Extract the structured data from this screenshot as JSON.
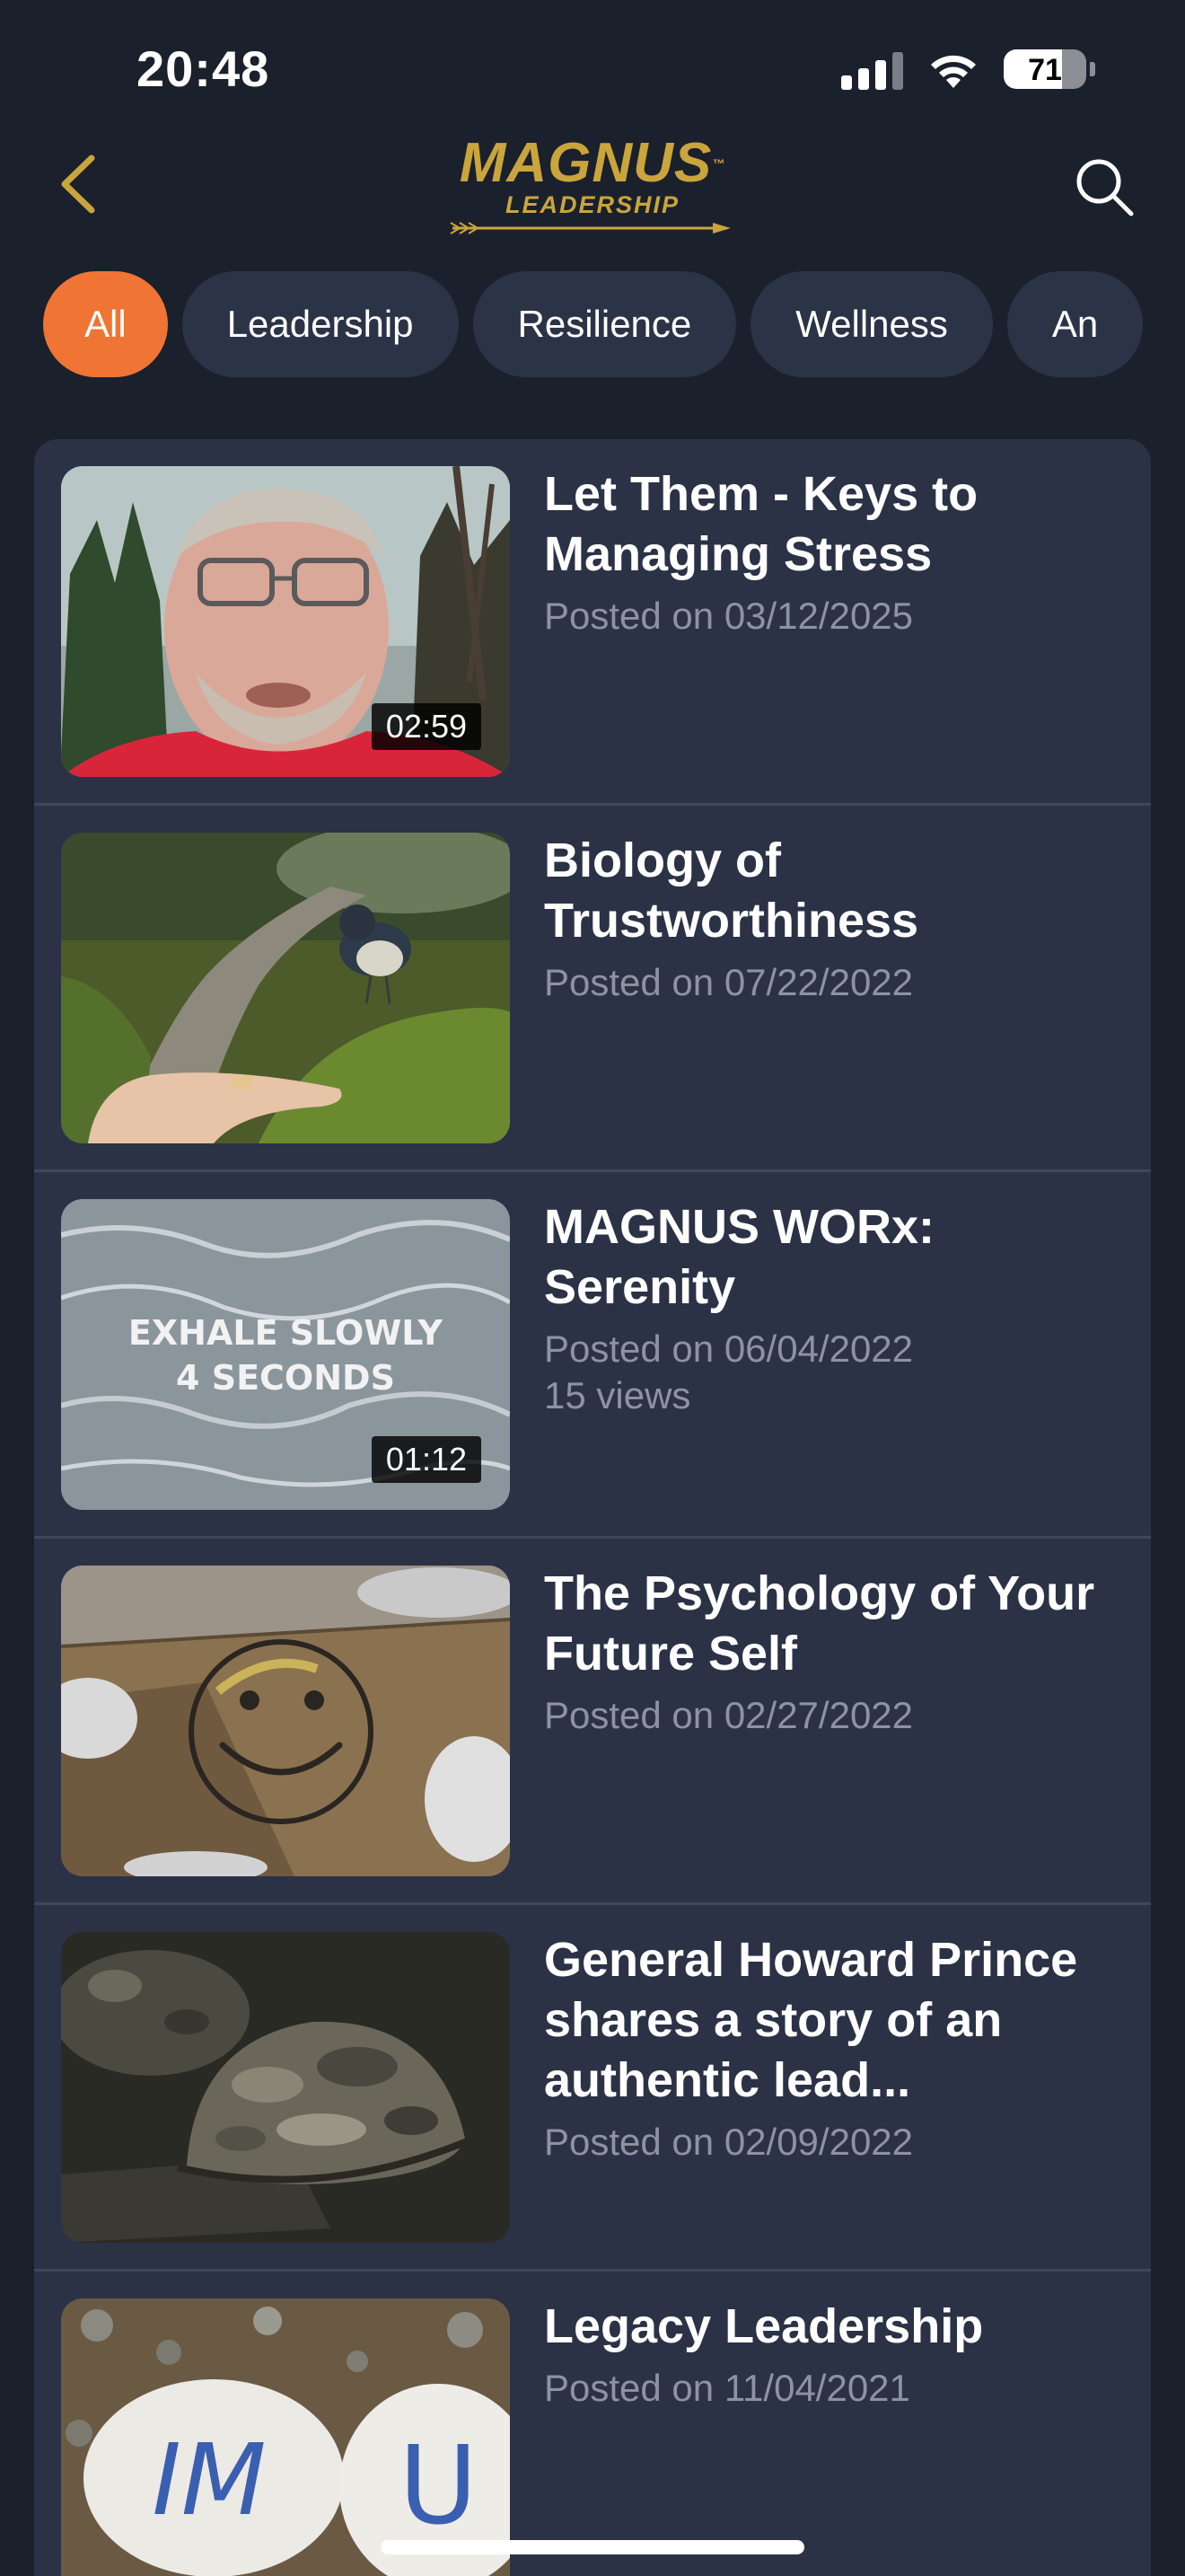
{
  "status_bar": {
    "time": "20:48",
    "battery_level": "71",
    "battery_fraction": 0.71
  },
  "header": {
    "back_icon": "chevron-left-icon",
    "search_icon": "search-icon",
    "logo": {
      "main": "MAGNUS",
      "sub": "LEADERSHIP",
      "tm": "™"
    },
    "accent_color": "#c9a53c"
  },
  "filters": [
    {
      "label": "All",
      "active": true
    },
    {
      "label": "Leadership",
      "active": false
    },
    {
      "label": "Resilience",
      "active": false
    },
    {
      "label": "Wellness",
      "active": false
    },
    {
      "label": "An",
      "active": false
    }
  ],
  "active_chip_color": "#f07434",
  "videos": [
    {
      "title": "Let Them - Keys to Managing Stress",
      "posted": "Posted on 03/12/2025",
      "duration": "02:59",
      "views": ""
    },
    {
      "title": "Biology of Trustworthiness",
      "posted": "Posted on 07/22/2022",
      "duration": "",
      "views": ""
    },
    {
      "title": "MAGNUS WORx: Serenity",
      "posted": "Posted on 06/04/2022",
      "duration": "01:12",
      "views": "15 views",
      "thumb_text_1": "EXHALE SLOWLY",
      "thumb_text_2": "4 SECONDS"
    },
    {
      "title": "The Psychology of Your Future Self",
      "posted": "Posted on 02/27/2022",
      "duration": "",
      "views": ""
    },
    {
      "title": "General Howard Prince shares a story of an authentic lead...",
      "posted": "Posted on 02/09/2022",
      "duration": "",
      "views": ""
    },
    {
      "title": "Legacy Leadership",
      "posted": "Posted on 11/04/2021",
      "duration": "",
      "views": "",
      "thumb_text_1": "IM",
      "thumb_text_2": "U"
    }
  ]
}
